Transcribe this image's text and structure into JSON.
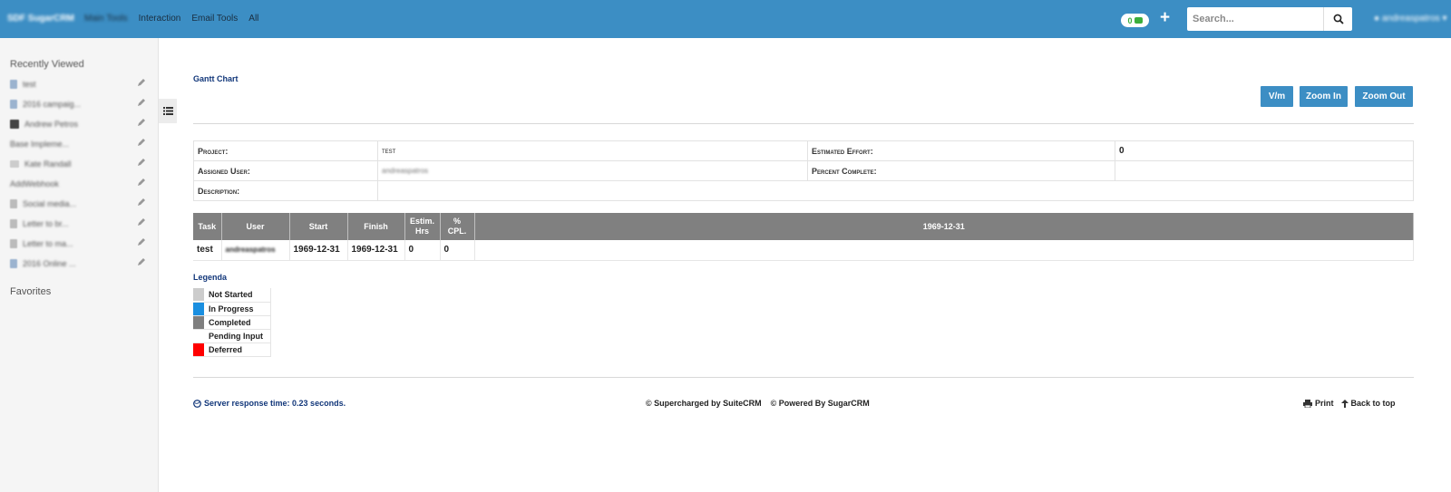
{
  "topbar": {
    "brand": "SDF SugarCRM",
    "nav": [
      "Main Tools",
      "Interaction",
      "Email Tools",
      "All"
    ],
    "notifications_count": "0",
    "search_placeholder": "Search...",
    "user": "andreaspatros"
  },
  "sidebar": {
    "recently_viewed_title": "Recently Viewed",
    "favorites_title": "Favorites",
    "items": [
      {
        "label": "test"
      },
      {
        "label": "2016 campaig..."
      },
      {
        "label": "Andrew Petros"
      },
      {
        "label": "Base Impleme..."
      },
      {
        "label": "Kate Randall"
      },
      {
        "label": "AddWebhook"
      },
      {
        "label": "Social media..."
      },
      {
        "label": "Letter to br..."
      },
      {
        "label": "Letter to ma..."
      },
      {
        "label": "2016 Online ..."
      }
    ]
  },
  "main": {
    "title": "Gantt Chart",
    "buttons": {
      "vm": "V/m",
      "zoom_in": "Zoom In",
      "zoom_out": "Zoom Out"
    },
    "details": {
      "project_label": "Project:",
      "project_value": "test",
      "estimated_effort_label": "Estimated Effort:",
      "estimated_effort_value": "0",
      "assigned_user_label": "Assigned User:",
      "assigned_user_value": "andreaspatros",
      "percent_complete_label": "Percent Complete:",
      "percent_complete_value": "",
      "description_label": "Description:",
      "description_value": ""
    },
    "gantt": {
      "headers": {
        "task": "Task",
        "user": "User",
        "start": "Start",
        "finish": "Finish",
        "estim_1": "Estim.",
        "estim_2": "Hrs",
        "pct_1": "%",
        "pct_2": "CPL.",
        "date": "1969-12-31"
      },
      "row": {
        "task": "test",
        "user": "andreaspatros",
        "start": "1969-12-31",
        "finish": "1969-12-31",
        "hrs": "0",
        "pct": "0"
      }
    },
    "legend": {
      "title": "Legenda",
      "items": [
        {
          "label": "Not Started",
          "color": "#cccccc"
        },
        {
          "label": "In Progress",
          "color": "#1a8fe0"
        },
        {
          "label": "Completed",
          "color": "#7f7f7f"
        },
        {
          "label": "Pending Input",
          "color": "#ffffff"
        },
        {
          "label": "Deferred",
          "color": "#ff0000"
        }
      ]
    }
  },
  "footer": {
    "response_time": "Server response time: 0.23 seconds.",
    "supercharged": "© Supercharged by SuiteCRM",
    "powered": "© Powered By SugarCRM",
    "print": "Print",
    "back_to_top": "Back to top"
  }
}
